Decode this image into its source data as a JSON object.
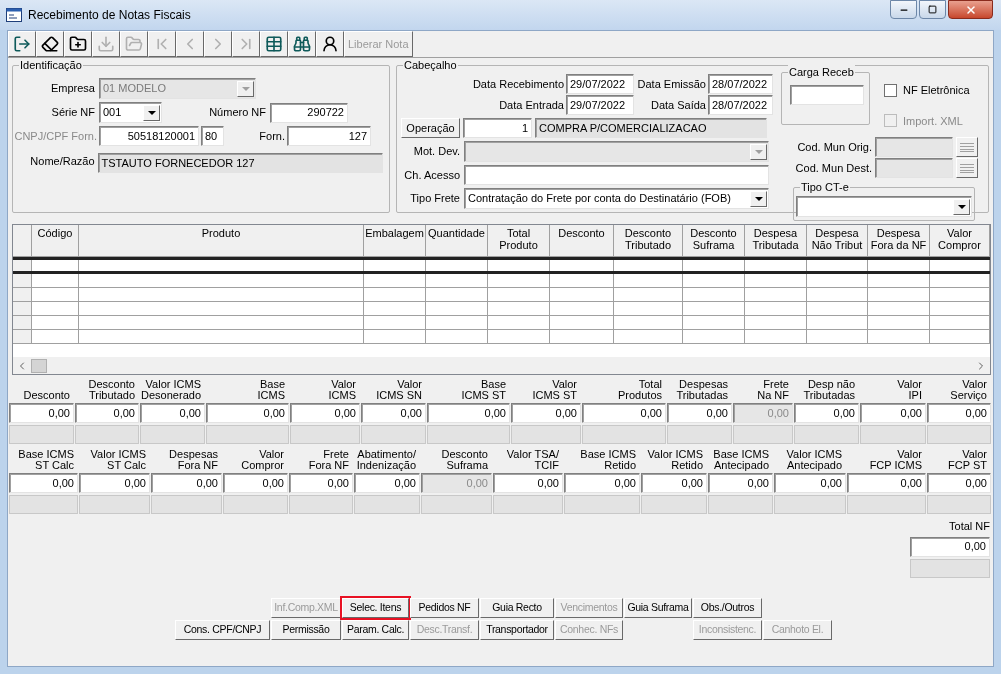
{
  "window": {
    "title": "Recebimento de Notas Fiscais"
  },
  "toolbar": [
    {
      "kind": "icon",
      "disabled": false
    },
    {
      "kind": "icon",
      "disabled": false
    },
    {
      "kind": "icon",
      "disabled": false
    },
    {
      "kind": "icon",
      "disabled": true
    },
    {
      "kind": "icon",
      "disabled": true
    },
    {
      "kind": "icon",
      "disabled": true
    },
    {
      "kind": "icon",
      "disabled": true
    },
    {
      "kind": "icon",
      "disabled": true
    },
    {
      "kind": "icon",
      "disabled": true
    },
    {
      "kind": "icon",
      "disabled": false
    },
    {
      "kind": "icon",
      "disabled": false
    },
    {
      "kind": "icon",
      "disabled": false
    },
    {
      "kind": "text",
      "label": "Liberar Nota",
      "disabled": true
    }
  ],
  "identificacao": {
    "title": "Identificação",
    "empresa": {
      "label": "Empresa",
      "value": "01 MODELO",
      "disabled": true
    },
    "serie": {
      "label": "Série NF",
      "value": "001"
    },
    "numero": {
      "label": "Número NF",
      "value": "290722"
    },
    "cnpj": {
      "label": "CNPJ/CPF Forn.",
      "value": "50518120001",
      "suffix": "80",
      "disabled": true
    },
    "forn": {
      "label": "Forn.",
      "value": "127"
    },
    "nome": {
      "label": "Nome/Razão",
      "value": "TSTAUTO FORNECEDOR 127"
    }
  },
  "cabecalho": {
    "title": "Cabeçalho",
    "data_recebimento": {
      "label": "Data Recebimento",
      "value": "29/07/2022"
    },
    "data_emissao": {
      "label": "Data Emissão",
      "value": "28/07/2022"
    },
    "data_entrada": {
      "label": "Data Entrada",
      "value": "29/07/2022"
    },
    "data_saida": {
      "label": "Data Saída",
      "value": "28/07/2022"
    },
    "operacao": {
      "button": "Operação",
      "code": "1",
      "description": "COMPRA P/COMERCIALIZACAO"
    },
    "mot_dev": {
      "label": "Mot. Dev.",
      "disabled": true
    },
    "ch_acesso": {
      "label": "Ch. Acesso"
    },
    "tipo_frete": {
      "label": "Tipo Frete",
      "value": "Contratação do Frete por conta do Destinatário (FOB)"
    },
    "carga_receb": {
      "title": "Carga Receb"
    },
    "nf_eletronica": {
      "label": "NF Eletrônica",
      "checked": false,
      "disabled": false
    },
    "import_xml": {
      "label": "Import. XML",
      "checked": false,
      "disabled": true
    },
    "cod_mun_orig": {
      "label": "Cod. Mun Orig.",
      "disabled": true
    },
    "cod_mun_dest": {
      "label": "Cod. Mun Dest.",
      "disabled": true
    },
    "tipo_cte": {
      "title": "Tipo CT-e"
    }
  },
  "items_table": {
    "columns": [
      "Código",
      "Produto",
      "Embalagem",
      "Quantidade",
      "Total\nProduto",
      "Desconto",
      "Desconto\nTributado",
      "Desconto\nSuframa",
      "Despesa\nTributada",
      "Despesa\nNão Tribut",
      "Despesa\nFora da NF",
      "Valor\nCompror"
    ],
    "rows": [
      {
        "selected": true
      },
      {
        "selected": false
      },
      {
        "selected": false
      },
      {
        "selected": false
      },
      {
        "selected": false
      },
      {
        "selected": false
      }
    ]
  },
  "totals_1": [
    {
      "label": "Desconto",
      "value": "0,00",
      "disabled": false
    },
    {
      "label": "Desconto\nTributado",
      "value": "0,00",
      "disabled": false
    },
    {
      "label": "Valor ICMS\nDesonerado",
      "value": "0,00",
      "disabled": false
    },
    {
      "label": "Base\nICMS",
      "value": "0,00",
      "disabled": false
    },
    {
      "label": "Valor\nICMS",
      "value": "0,00",
      "disabled": false
    },
    {
      "label": "Valor\nICMS SN",
      "value": "0,00",
      "disabled": false
    },
    {
      "label": "Base\nICMS ST",
      "value": "0,00",
      "disabled": false
    },
    {
      "label": "Valor\nICMS ST",
      "value": "0,00",
      "disabled": false
    },
    {
      "label": "Total\nProdutos",
      "value": "0,00",
      "disabled": false
    },
    {
      "label": "Despesas\nTributadas",
      "value": "0,00",
      "disabled": false
    },
    {
      "label": "Frete\nNa NF",
      "value": "0,00",
      "disabled": true
    },
    {
      "label": "Desp não\nTributadas",
      "value": "0,00",
      "disabled": false
    },
    {
      "label": "Valor\nIPI",
      "value": "0,00",
      "disabled": false
    },
    {
      "label": "Valor\nServiço",
      "value": "0,00",
      "disabled": false
    }
  ],
  "totals_2": [
    {
      "label": "Base ICMS\nST Calc",
      "value": "0,00",
      "disabled": false
    },
    {
      "label": "Valor ICMS\nST Calc",
      "value": "0,00",
      "disabled": false
    },
    {
      "label": "Despesas\nFora NF",
      "value": "0,00",
      "disabled": false
    },
    {
      "label": "Valor\nCompror",
      "value": "0,00",
      "disabled": false
    },
    {
      "label": "Frete\nFora NF",
      "value": "0,00",
      "disabled": false
    },
    {
      "label": "Abatimento/\nIndenização",
      "value": "0,00",
      "disabled": false
    },
    {
      "label": "Desconto\nSuframa",
      "value": "0,00",
      "disabled": true
    },
    {
      "label": "Valor TSA/\nTCIF",
      "value": "0,00",
      "disabled": false
    },
    {
      "label": "Base ICMS\nRetido",
      "value": "0,00",
      "disabled": false
    },
    {
      "label": "Valor ICMS\nRetido",
      "value": "0,00",
      "disabled": false
    },
    {
      "label": "Base ICMS\nAntecipado",
      "value": "0,00",
      "disabled": false
    },
    {
      "label": "Valor ICMS\nAntecipado",
      "value": "0,00",
      "disabled": false
    },
    {
      "label": "Valor\nFCP ICMS",
      "value": "0,00",
      "disabled": false
    },
    {
      "label": "Valor\nFCP ST",
      "value": "0,00",
      "disabled": false
    }
  ],
  "total_nf": {
    "label": "Total NF",
    "value": "0,00"
  },
  "action_buttons": [
    {
      "items": [
        {
          "label": "Inf.Comp.XML",
          "disabled": true,
          "highlighted": false
        },
        {
          "label": "Selec. Itens",
          "disabled": false,
          "highlighted": true
        },
        {
          "label": "Pedidos NF",
          "disabled": false,
          "highlighted": false
        },
        {
          "label": "Guia Recto",
          "disabled": false,
          "highlighted": false
        },
        {
          "label": "Vencimentos",
          "disabled": true,
          "highlighted": false
        },
        {
          "label": "Guia Suframa",
          "disabled": false,
          "highlighted": false
        },
        {
          "label": "Obs./Outros",
          "disabled": false,
          "highlighted": false
        }
      ]
    },
    {
      "items": [
        {
          "label": "Cons. CPF/CNPJ",
          "disabled": false,
          "highlighted": false
        },
        {
          "label": "Permissão",
          "disabled": false,
          "highlighted": false
        },
        {
          "label": "Param. Calc.",
          "disabled": false,
          "highlighted": false
        },
        {
          "label": "Desc.Transf.",
          "disabled": true,
          "highlighted": false
        },
        {
          "label": "Transportador",
          "disabled": false,
          "highlighted": false
        },
        {
          "label": "Conhec. NFs",
          "disabled": true,
          "highlighted": false
        },
        {
          "label": "Inconsistenc.",
          "disabled": true,
          "highlighted": false
        },
        {
          "label": "Canhoto El.",
          "disabled": true,
          "highlighted": false
        }
      ]
    }
  ]
}
